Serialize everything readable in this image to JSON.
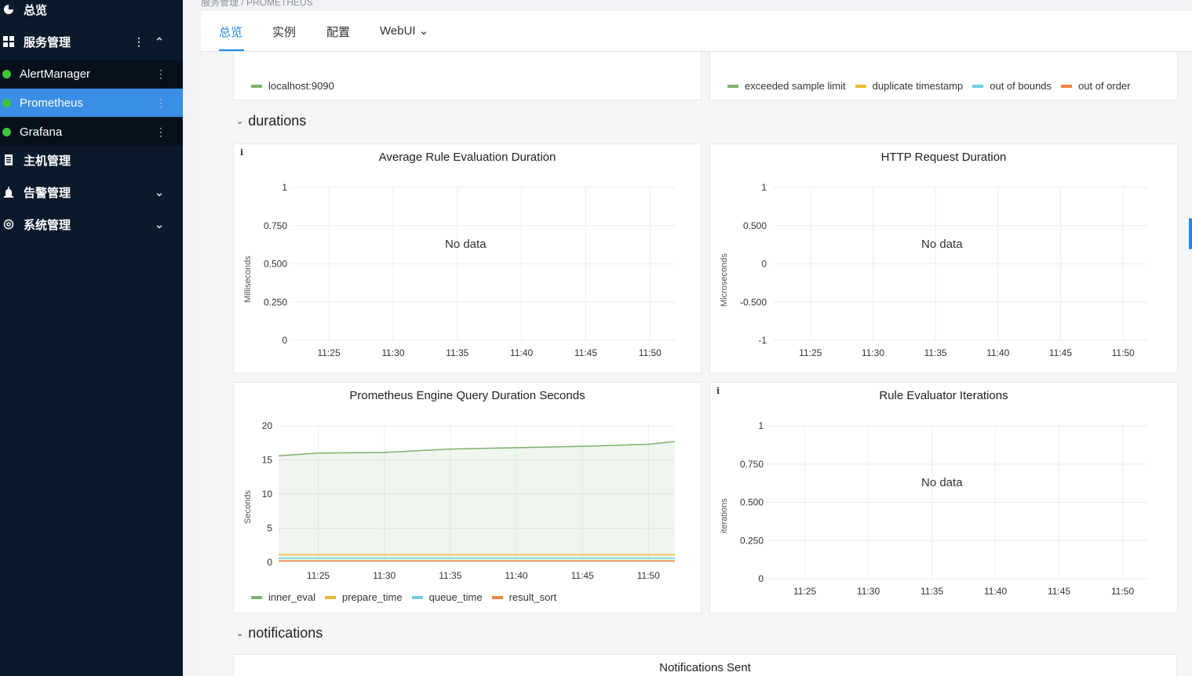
{
  "sidebar": {
    "overview": "总览",
    "service_mgmt": "服务管理",
    "services": [
      {
        "label": "AlertManager",
        "active": false
      },
      {
        "label": "Prometheus",
        "active": true
      },
      {
        "label": "Grafana",
        "active": false
      }
    ],
    "host_mgmt": "主机管理",
    "alert_mgmt": "告警管理",
    "system_mgmt": "系统管理",
    "kebab": "⋮",
    "caret_up": "⌃",
    "caret_down": "⌄"
  },
  "breadcrumb": {
    "text": "服务管理 / PROMETHEUS"
  },
  "tabs": [
    {
      "label": "总览",
      "active": true
    },
    {
      "label": "实例",
      "active": false
    },
    {
      "label": "配置",
      "active": false
    },
    {
      "label": "WebUI ⌄",
      "active": false
    }
  ],
  "top_legends": {
    "left": [
      "localhost:9090"
    ],
    "right": [
      "exceeded sample limit",
      "duplicate timestamp",
      "out of bounds",
      "out of order"
    ]
  },
  "sections": {
    "durations": "durations",
    "notifications": "notifications"
  },
  "info_icon": "i",
  "x_ticks": [
    "11:25",
    "11:30",
    "11:35",
    "11:40",
    "11:45",
    "11:50"
  ],
  "chart_data": [
    {
      "type": "line",
      "title": "Average Rule Evaluation Duration",
      "ylabel": "Milliseconds",
      "yticks": [
        "1",
        "0.750",
        "0.500",
        "0.250",
        "0"
      ],
      "ylim": [
        0,
        1
      ],
      "series": [],
      "annotation": "No data"
    },
    {
      "type": "line",
      "title": "HTTP Request Duration",
      "ylabel": "Microseconds",
      "yticks": [
        "1",
        "0.500",
        "0",
        "-0.500",
        "-1"
      ],
      "ylim": [
        -1,
        1
      ],
      "series": [],
      "annotation": "No data"
    },
    {
      "type": "area",
      "title": "Prometheus Engine Query Duration Seconds",
      "ylabel": "Seconds",
      "yticks": [
        "20",
        "15",
        "10",
        "5",
        "0"
      ],
      "ylim": [
        0,
        20
      ],
      "x": [
        "11:22",
        "11:25",
        "11:30",
        "11:35",
        "11:40",
        "11:45",
        "11:50",
        "11:52"
      ],
      "series": [
        {
          "name": "inner_eval",
          "color": "#7eb26d",
          "values": [
            15.6,
            16.0,
            16.1,
            16.6,
            16.8,
            17.0,
            17.3,
            17.7
          ]
        },
        {
          "name": "prepare_time",
          "color": "#eab839",
          "values": [
            1.1,
            1.1,
            1.1,
            1.1,
            1.1,
            1.1,
            1.1,
            1.1
          ]
        },
        {
          "name": "queue_time",
          "color": "#6ed0e0",
          "values": [
            0.6,
            0.6,
            0.6,
            0.6,
            0.6,
            0.6,
            0.6,
            0.6
          ]
        },
        {
          "name": "result_sort",
          "color": "#ef843c",
          "values": [
            0.2,
            0.2,
            0.2,
            0.2,
            0.2,
            0.2,
            0.2,
            0.2
          ]
        }
      ]
    },
    {
      "type": "line",
      "title": "Rule Evaluator Iterations",
      "ylabel": "iterations",
      "yticks": [
        "1",
        "0.750",
        "0.500",
        "0.250",
        "0"
      ],
      "ylim": [
        0,
        1
      ],
      "series": [],
      "annotation": "No data"
    }
  ],
  "notifications_panel": {
    "title": "Notifications Sent"
  },
  "legend_colors": {
    "localhost": "#7eb26d",
    "exceeded": "#7eb26d",
    "duplicate": "#eab839",
    "bounds": "#6ed0e0",
    "order": "#ef843c"
  }
}
